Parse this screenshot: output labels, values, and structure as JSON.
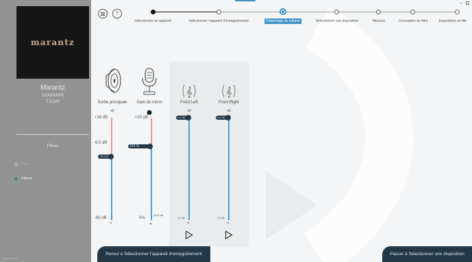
{
  "sidebar": {
    "logo_text": "marantz",
    "device_name": "Marantz",
    "device_serial": "XXXXXXXX",
    "device_config": "7.3.2ch",
    "filters_heading": "Filtres",
    "filters": [
      {
        "label": "Plein",
        "selected": false
      },
      {
        "label": "Hurne",
        "selected": true
      }
    ],
    "footer": "Sans parents"
  },
  "stepper": {
    "steps": [
      {
        "label": "Sélectionner un appareil",
        "state": "done"
      },
      {
        "label": "Sélectionner l'appareil d'enregistrement",
        "state": "todo"
      },
      {
        "label": "Étalonnage du volume",
        "state": "active"
      },
      {
        "label": "Sélectionner une disposition",
        "state": "todo"
      },
      {
        "label": "Mesurer",
        "state": "todo"
      },
      {
        "label": "Conception du filtre",
        "state": "todo"
      },
      {
        "label": "Exportation du filtr",
        "state": "todo"
      }
    ],
    "accent_color": "#3d8fc6"
  },
  "channels": {
    "main_output": {
      "label": "Sortie principale",
      "max_label": "+18 dB",
      "mid_label": "-6.5 dB",
      "min_label": "-80 dB",
      "handle_value": "-18.5 dB"
    },
    "mic_gain": {
      "label": "Gain du micro",
      "max_label": "+20 dB",
      "min_label": "0%",
      "handle_value": "100 %",
      "min_extra": "-60.8 dB"
    },
    "front_left": {
      "label": "Front Left",
      "handle_value": "0.0 dB",
      "min_value": "-12 dB"
    },
    "front_right": {
      "label": "Front Right",
      "handle_value": "0.0 dB",
      "min_value": "-12 dB"
    }
  },
  "icons": {
    "menu": "menu-icon",
    "help": "help-icon",
    "help_glyph": "?",
    "minimize_glyph": "–",
    "speaker": "speaker-icon",
    "microphone": "microphone-icon",
    "treble_clef": "treble-clef-icon",
    "play": "play-icon"
  },
  "colors": {
    "sidebar_bg": "#939393",
    "track_above": "#e39a9a",
    "track_below": "#4a9fd9",
    "handle": "#233746",
    "button_bg": "#233746"
  },
  "buttons": {
    "back": "Retour à Sélectionner l'appareil d'enregistrement",
    "next": "Passer à Sélectionner une disposition"
  }
}
